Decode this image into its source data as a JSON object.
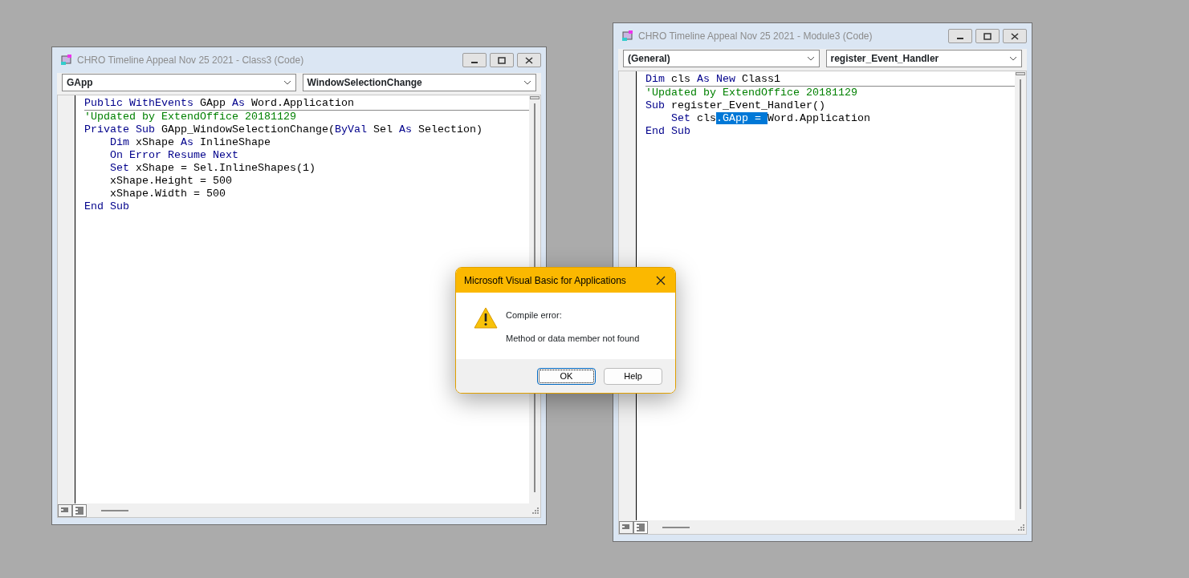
{
  "windows": [
    {
      "title": "CHRO Timeline Appeal Nov 25 2021 - Class3 (Code)",
      "object_combo": "GApp",
      "procedure_combo": "WindowSelectionChange",
      "lines": [
        {
          "tokens": [
            {
              "text": "Public WithEvents",
              "kind": "keyword"
            },
            {
              "text": " GApp ",
              "kind": "plain"
            },
            {
              "text": "As",
              "kind": "keyword"
            },
            {
              "text": " Word.Application",
              "kind": "plain"
            }
          ]
        },
        {
          "tokens": [
            {
              "text": "'Updated by ExtendOffice 20181129",
              "kind": "comment"
            }
          ]
        },
        {
          "tokens": [
            {
              "text": "Private Sub",
              "kind": "keyword"
            },
            {
              "text": " GApp_WindowSelectionChange(",
              "kind": "plain"
            },
            {
              "text": "ByVal",
              "kind": "keyword"
            },
            {
              "text": " Sel ",
              "kind": "plain"
            },
            {
              "text": "As",
              "kind": "keyword"
            },
            {
              "text": " Selection)",
              "kind": "plain"
            }
          ]
        },
        {
          "tokens": [
            {
              "text": "    Dim",
              "kind": "keyword"
            },
            {
              "text": " xShape ",
              "kind": "plain"
            },
            {
              "text": "As",
              "kind": "keyword"
            },
            {
              "text": " InlineShape",
              "kind": "plain"
            }
          ]
        },
        {
          "tokens": [
            {
              "text": "    On Error Resume Next",
              "kind": "keyword"
            }
          ]
        },
        {
          "tokens": [
            {
              "text": "    Set",
              "kind": "keyword"
            },
            {
              "text": " xShape = Sel.InlineShapes(1)",
              "kind": "plain"
            }
          ]
        },
        {
          "tokens": [
            {
              "text": "    xShape.Height = 500",
              "kind": "plain"
            }
          ]
        },
        {
          "tokens": [
            {
              "text": "    xShape.Width = 500",
              "kind": "plain"
            }
          ]
        },
        {
          "tokens": [
            {
              "text": "End Sub",
              "kind": "keyword"
            }
          ]
        }
      ]
    },
    {
      "title": "CHRO Timeline Appeal Nov 25 2021 - Module3 (Code)",
      "object_combo": "(General)",
      "procedure_combo": "register_Event_Handler",
      "lines": [
        {
          "tokens": [
            {
              "text": "Dim",
              "kind": "keyword"
            },
            {
              "text": " cls ",
              "kind": "plain"
            },
            {
              "text": "As New",
              "kind": "keyword"
            },
            {
              "text": " Class1",
              "kind": "plain"
            }
          ]
        },
        {
          "tokens": [
            {
              "text": "'Updated by ExtendOffice 20181129",
              "kind": "comment"
            }
          ]
        },
        {
          "tokens": [
            {
              "text": "Sub",
              "kind": "keyword"
            },
            {
              "text": " register_Event_Handler()",
              "kind": "plain"
            }
          ]
        },
        {
          "tokens": [
            {
              "text": "    Set",
              "kind": "keyword"
            },
            {
              "text": " cls",
              "kind": "plain"
            },
            {
              "text": ".GApp = ",
              "kind": "selected"
            },
            {
              "text": "Word.Application",
              "kind": "plain"
            }
          ]
        },
        {
          "tokens": [
            {
              "text": "End Sub",
              "kind": "keyword"
            }
          ]
        }
      ]
    }
  ],
  "dialog": {
    "title": "Microsoft Visual Basic for Applications",
    "heading": "Compile error:",
    "message": "Method or data member not found",
    "buttons": [
      {
        "label": "OK",
        "selected": true
      },
      {
        "label": "Help",
        "selected": false
      }
    ]
  }
}
